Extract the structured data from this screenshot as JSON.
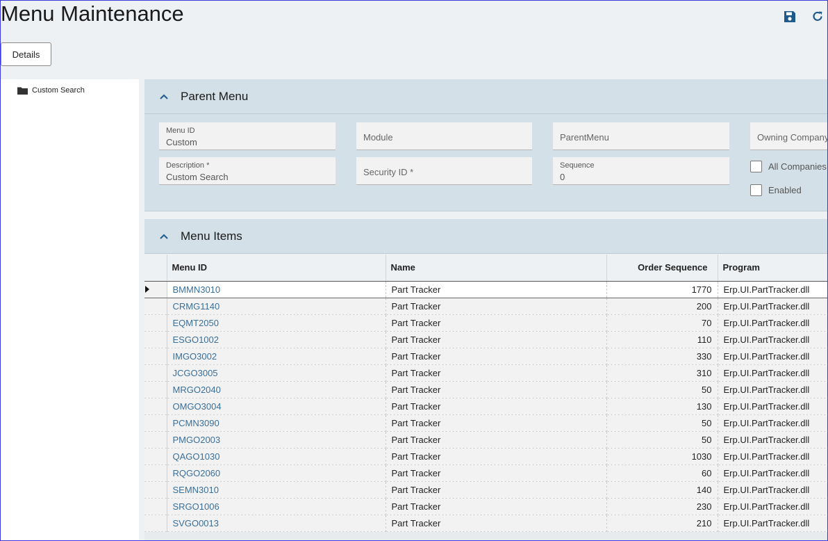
{
  "page": {
    "title": "Menu Maintenance"
  },
  "toolbar": {
    "save_icon": "save-icon",
    "refresh_icon": "refresh-icon"
  },
  "details_button": {
    "label": "Details"
  },
  "tree": {
    "items": [
      {
        "label": "Custom Search",
        "icon": "folder-icon"
      }
    ]
  },
  "parent_menu": {
    "title": "Parent Menu",
    "fields": {
      "menu_id": {
        "label": "Menu ID",
        "value": "Custom"
      },
      "module": {
        "placeholder": "Module"
      },
      "parent_menu": {
        "placeholder": "ParentMenu"
      },
      "owning_company": {
        "placeholder": "Owning Company"
      },
      "description": {
        "label": "Description *",
        "value": "Custom Search"
      },
      "security_id": {
        "placeholder": "Security ID *"
      },
      "sequence": {
        "label": "Sequence",
        "value": "0"
      }
    },
    "checkboxes": {
      "all_companies": {
        "label": "All Companies",
        "checked": false
      },
      "enabled": {
        "label": "Enabled",
        "checked": false
      }
    }
  },
  "menu_items": {
    "title": "Menu Items",
    "columns": [
      "Menu ID",
      "Name",
      "Order Sequence",
      "Program"
    ],
    "rows": [
      {
        "menu_id": "BMMN3010",
        "name": "Part Tracker",
        "order": "1770",
        "program": "Erp.UI.PartTracker.dll"
      },
      {
        "menu_id": "CRMG1140",
        "name": "Part Tracker",
        "order": "200",
        "program": "Erp.UI.PartTracker.dll"
      },
      {
        "menu_id": "EQMT2050",
        "name": "Part Tracker",
        "order": "70",
        "program": "Erp.UI.PartTracker.dll"
      },
      {
        "menu_id": "ESGO1002",
        "name": "Part Tracker",
        "order": "110",
        "program": "Erp.UI.PartTracker.dll"
      },
      {
        "menu_id": "IMGO3002",
        "name": "Part Tracker",
        "order": "330",
        "program": "Erp.UI.PartTracker.dll"
      },
      {
        "menu_id": "JCGO3005",
        "name": "Part Tracker",
        "order": "310",
        "program": "Erp.UI.PartTracker.dll"
      },
      {
        "menu_id": "MRGO2040",
        "name": "Part Tracker",
        "order": "50",
        "program": "Erp.UI.PartTracker.dll"
      },
      {
        "menu_id": "OMGO3004",
        "name": "Part Tracker",
        "order": "130",
        "program": "Erp.UI.PartTracker.dll"
      },
      {
        "menu_id": "PCMN3090",
        "name": "Part Tracker",
        "order": "50",
        "program": "Erp.UI.PartTracker.dll"
      },
      {
        "menu_id": "PMGO2003",
        "name": "Part Tracker",
        "order": "50",
        "program": "Erp.UI.PartTracker.dll"
      },
      {
        "menu_id": "QAGO1030",
        "name": "Part Tracker",
        "order": "1030",
        "program": "Erp.UI.PartTracker.dll"
      },
      {
        "menu_id": "RQGO2060",
        "name": "Part Tracker",
        "order": "60",
        "program": "Erp.UI.PartTracker.dll"
      },
      {
        "menu_id": "SEMN3010",
        "name": "Part Tracker",
        "order": "140",
        "program": "Erp.UI.PartTracker.dll"
      },
      {
        "menu_id": "SRGO1006",
        "name": "Part Tracker",
        "order": "230",
        "program": "Erp.UI.PartTracker.dll"
      },
      {
        "menu_id": "SVGO0013",
        "name": "Part Tracker",
        "order": "210",
        "program": "Erp.UI.PartTracker.dll"
      }
    ]
  },
  "colors": {
    "accent": "#1e5a8c",
    "link": "#3a6f9a",
    "panel": "#d3e0e7",
    "page_bg": "#eef1f4"
  }
}
